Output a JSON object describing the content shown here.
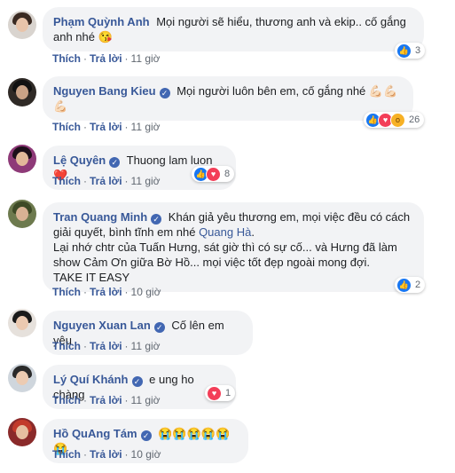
{
  "comments": [
    {
      "author": "Phạm Quỳnh Anh",
      "verified": false,
      "text": "Mọi người sẽ hiểu, thương anh và ekip.. cố gắng anh nhé 😘",
      "reactions": {
        "types": [
          "like"
        ],
        "count": "3"
      },
      "actions": {
        "like": "Thích",
        "reply": "Trả lời",
        "time": "11 giờ"
      }
    },
    {
      "author": "Nguyen Bang Kieu",
      "verified": true,
      "text": "Mọi người luôn bên em, cố gắng nhé 💪🏻💪🏻💪🏻",
      "reactions": {
        "types": [
          "like",
          "love",
          "wow"
        ],
        "count": "26"
      },
      "actions": {
        "like": "Thích",
        "reply": "Trả lời",
        "time": "11 giờ"
      }
    },
    {
      "author": "Lệ Quyên",
      "verified": true,
      "text": "Thuong lam luon❤️",
      "reactions": {
        "types": [
          "like",
          "love"
        ],
        "count": "8"
      },
      "actions": {
        "like": "Thích",
        "reply": "Trả lời",
        "time": "11 giờ"
      }
    },
    {
      "author": "Tran Quang Minh",
      "verified": true,
      "text_before_mention": "Khán giả yêu thương em, mọi việc đều có cách giải quyết, bình tĩnh em nhé ",
      "mention": "Quang Hà",
      "text_after_mention": ".",
      "text_line2": "Lại nhớ chtr của Tuấn Hưng, sát giờ thì có sự cố... và Hưng đã làm show Cảm Ơn giữa Bờ Hồ... mọi việc tốt đẹp ngoài mong đợi.",
      "text_line3": "TAKE IT EASY",
      "reactions": {
        "types": [
          "like"
        ],
        "count": "2"
      },
      "actions": {
        "like": "Thích",
        "reply": "Trả lời",
        "time": "10 giờ"
      }
    },
    {
      "author": "Nguyen Xuan Lan",
      "verified": true,
      "text": "Cố lên em yêu",
      "actions": {
        "like": "Thích",
        "reply": "Trả lời",
        "time": "11 giờ"
      }
    },
    {
      "author": "Lý Quí Khánh",
      "verified": true,
      "text": "e ung ho chàng",
      "reactions": {
        "types": [
          "love"
        ],
        "count": "1"
      },
      "actions": {
        "like": "Thích",
        "reply": "Trả lời",
        "time": "11 giờ"
      }
    },
    {
      "author": "Hồ QuAng Tám",
      "verified": true,
      "text": "😭😭😭😭😭😭",
      "actions": {
        "like": "Thích",
        "reply": "Trả lời",
        "time": "10 giờ"
      }
    }
  ],
  "colors": {
    "link": "#385898",
    "bubble": "#f2f3f5",
    "like": "#1877f2",
    "love": "#f33e58",
    "wow": "#f7b125"
  },
  "icons": {
    "verified": "verified-badge-icon",
    "like": "like-reaction-icon",
    "love": "love-reaction-icon",
    "wow": "wow-reaction-icon"
  }
}
